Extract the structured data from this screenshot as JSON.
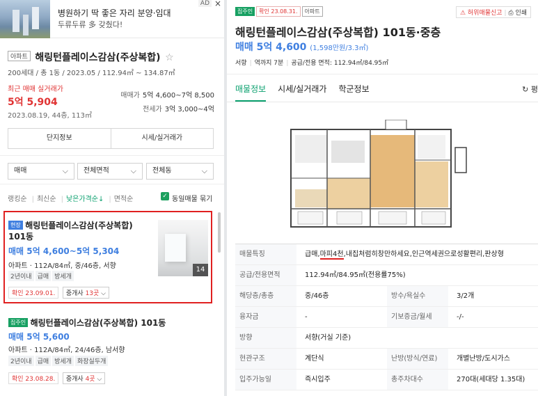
{
  "ad": {
    "title": "병원하기 딱 좋은 자리 분양·임대",
    "subtitle": "두류두류 多 갖췄다!",
    "badge": "AD",
    "close": "×"
  },
  "complex": {
    "type_tag": "아파트",
    "name": "해링턴플레이스감삼(주상복합)",
    "star": "☆",
    "info": "200세대 / 총 1동 / 2023.05 / 112.94㎡ ~ 134.87㎡",
    "recent_label": "최근 매매 실거래가",
    "recent_price": "5억 5,904",
    "recent_date": "2023.08.19, 44층, 113㎡",
    "sale_label": "매매가",
    "sale_range": "5억 4,600~7억 8,500",
    "jeonse_label": "전세가",
    "jeonse_range": "3억 3,000~4억",
    "tab1": "단지정보",
    "tab2": "시세/실거래가"
  },
  "filters": {
    "trade": "매매",
    "area": "전체면적",
    "dong": "전체동"
  },
  "sort": {
    "ranking": "랭킹순",
    "latest": "최신순",
    "lowprice": "낮은가격순↓",
    "area": "면적순",
    "group_label": "동일매물 묶기"
  },
  "listings": [
    {
      "tag": "현장",
      "title": "해링턴플레이스감삼(주상복합) 101동",
      "price": "매매 5억 4,600~5억 5,304",
      "spec": "아파트 · 112A/84㎡, 중/46층, 서향",
      "chips": [
        "2년이내",
        "급매",
        "방세개"
      ],
      "confirm": "확인 23.09.01.",
      "agent_prefix": "중개사 ",
      "agent_count": "13곳",
      "agent_suffix": " ⌵",
      "photo_count": "14"
    },
    {
      "tag": "집주인",
      "title": "해링턴플레이스감삼(주상복합) 101동",
      "price": "매매 5억 5,600",
      "spec": "아파트 · 112A/84㎡, 24/46층, 남서향",
      "chips": [
        "2년이내",
        "급매",
        "방세개",
        "화장실두개"
      ],
      "confirm": "확인 23.08.28.",
      "agent_prefix": "중개사 ",
      "agent_count": "4곳",
      "agent_suffix": " ⌵"
    }
  ],
  "detail": {
    "tag_owner": "집주인",
    "tag_confirm": "확인 23.08.31.",
    "tag_type": "아파트",
    "report": "허위매물신고",
    "print": "인쇄",
    "title": "해링턴플레이스감삼(주상복합) 101동·중층",
    "price": "매매 5억 4,600",
    "price_per": "(1,598만원/3.3㎡)",
    "direction": "서향",
    "walk": "역까지 7분",
    "area_info": "공급/전용 면적: 112.94㎡/84.95㎡",
    "tabs": [
      "매물정보",
      "시세/실거래가",
      "학군정보"
    ],
    "refresh": "↻ 평",
    "rows": [
      {
        "k": "매물특징",
        "v_pre": "급매,",
        "v_hl": "마피4천",
        "v_post": ",내집처럼히창만하세요,인근역세권으로성활편리,판상형"
      },
      {
        "k": "공급/전용면적",
        "v": "112.94㎡/84.95㎡(전용률75%)"
      },
      {
        "k": "해당층/총층",
        "v": "중/46층",
        "k2": "방수/욕실수",
        "v2": "3/2개"
      },
      {
        "k": "융자금",
        "v": "-",
        "k2": "기보증금/월세",
        "v2": "-/-"
      },
      {
        "k": "방향",
        "v": "서향(거실 기준)"
      },
      {
        "k": "현관구조",
        "v": "계단식",
        "k2": "난방(방식/연료)",
        "v2": "개별난방/도시가스"
      },
      {
        "k": "입주가능일",
        "v": "즉시입주",
        "k2": "총주차대수",
        "v2": "270대(세대당 1.35대)"
      }
    ]
  },
  "colors": {
    "accent_green": "#0aa06e",
    "price_blue": "#3f7fe0",
    "price_red": "#e03333",
    "highlight_red": "#e02020"
  }
}
